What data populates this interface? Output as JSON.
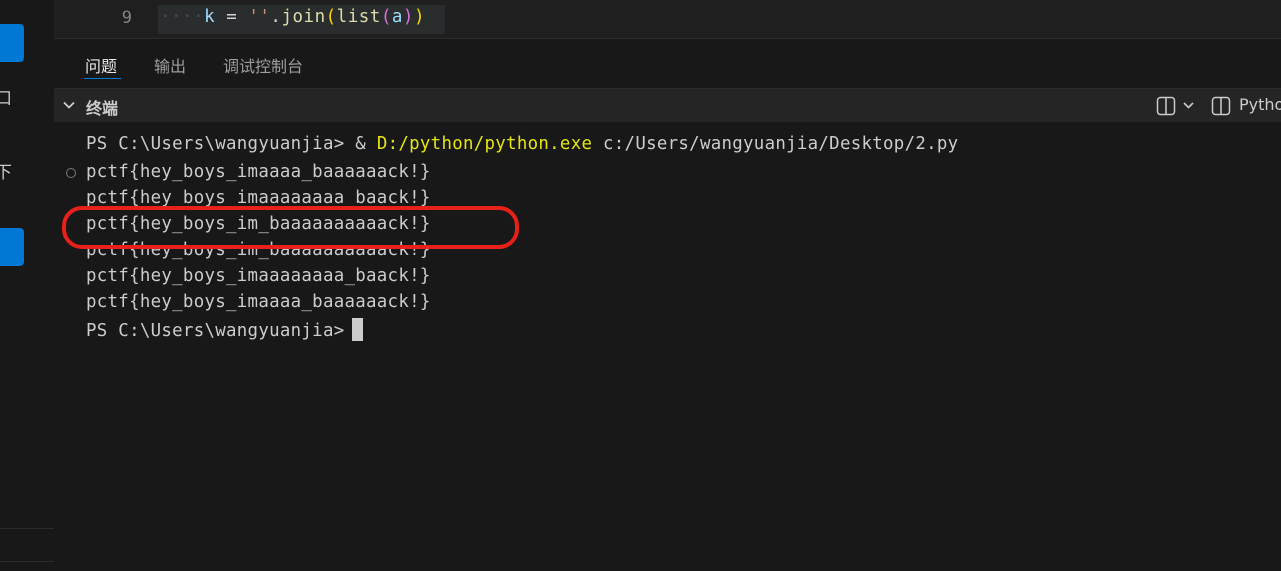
{
  "sidebar": {
    "chars": [
      "口",
      "下"
    ]
  },
  "editor": {
    "line_number": "9",
    "code": {
      "indent": "····",
      "var": "k",
      "eq": "=",
      "str": "''",
      "dot": ".",
      "join": "join",
      "paren_open": "(",
      "list": "list",
      "paren2_open": "(",
      "arg": "a",
      "paren2_close": ")",
      "paren_close": ")"
    }
  },
  "panel": {
    "tabs": [
      {
        "label": "问题",
        "active": true
      },
      {
        "label": "输出",
        "active": false
      },
      {
        "label": "调试控制台",
        "active": false
      }
    ]
  },
  "terminal": {
    "title": "终端",
    "profile_label": "Pytho",
    "prompt": "PS C:\\Users\\wangyuanjia>",
    "command_amp": "&",
    "command_exe": "D:/python/python.exe",
    "command_arg": "c:/Users/wangyuanjia/Desktop/2.py",
    "output_lines": [
      "pctf{hey_boys_imaaaa_baaaaaack!}",
      "pctf{hey_boys_imaaaaaaaa_baack!}",
      "pctf{hey_boys_im_baaaaaaaaaack!}",
      "pctf{hey_boys_im_baaaaaaaaaack!}",
      "pctf{hey_boys_imaaaaaaaa_baack!}",
      "pctf{hey_boys_imaaaa_baaaaaack!}"
    ],
    "final_prompt": "PS C:\\Users\\wangyuanjia>"
  },
  "colors": {
    "accent": "#0078d4",
    "annotation": "#e8201a",
    "command_yellow": "#e5e510"
  }
}
